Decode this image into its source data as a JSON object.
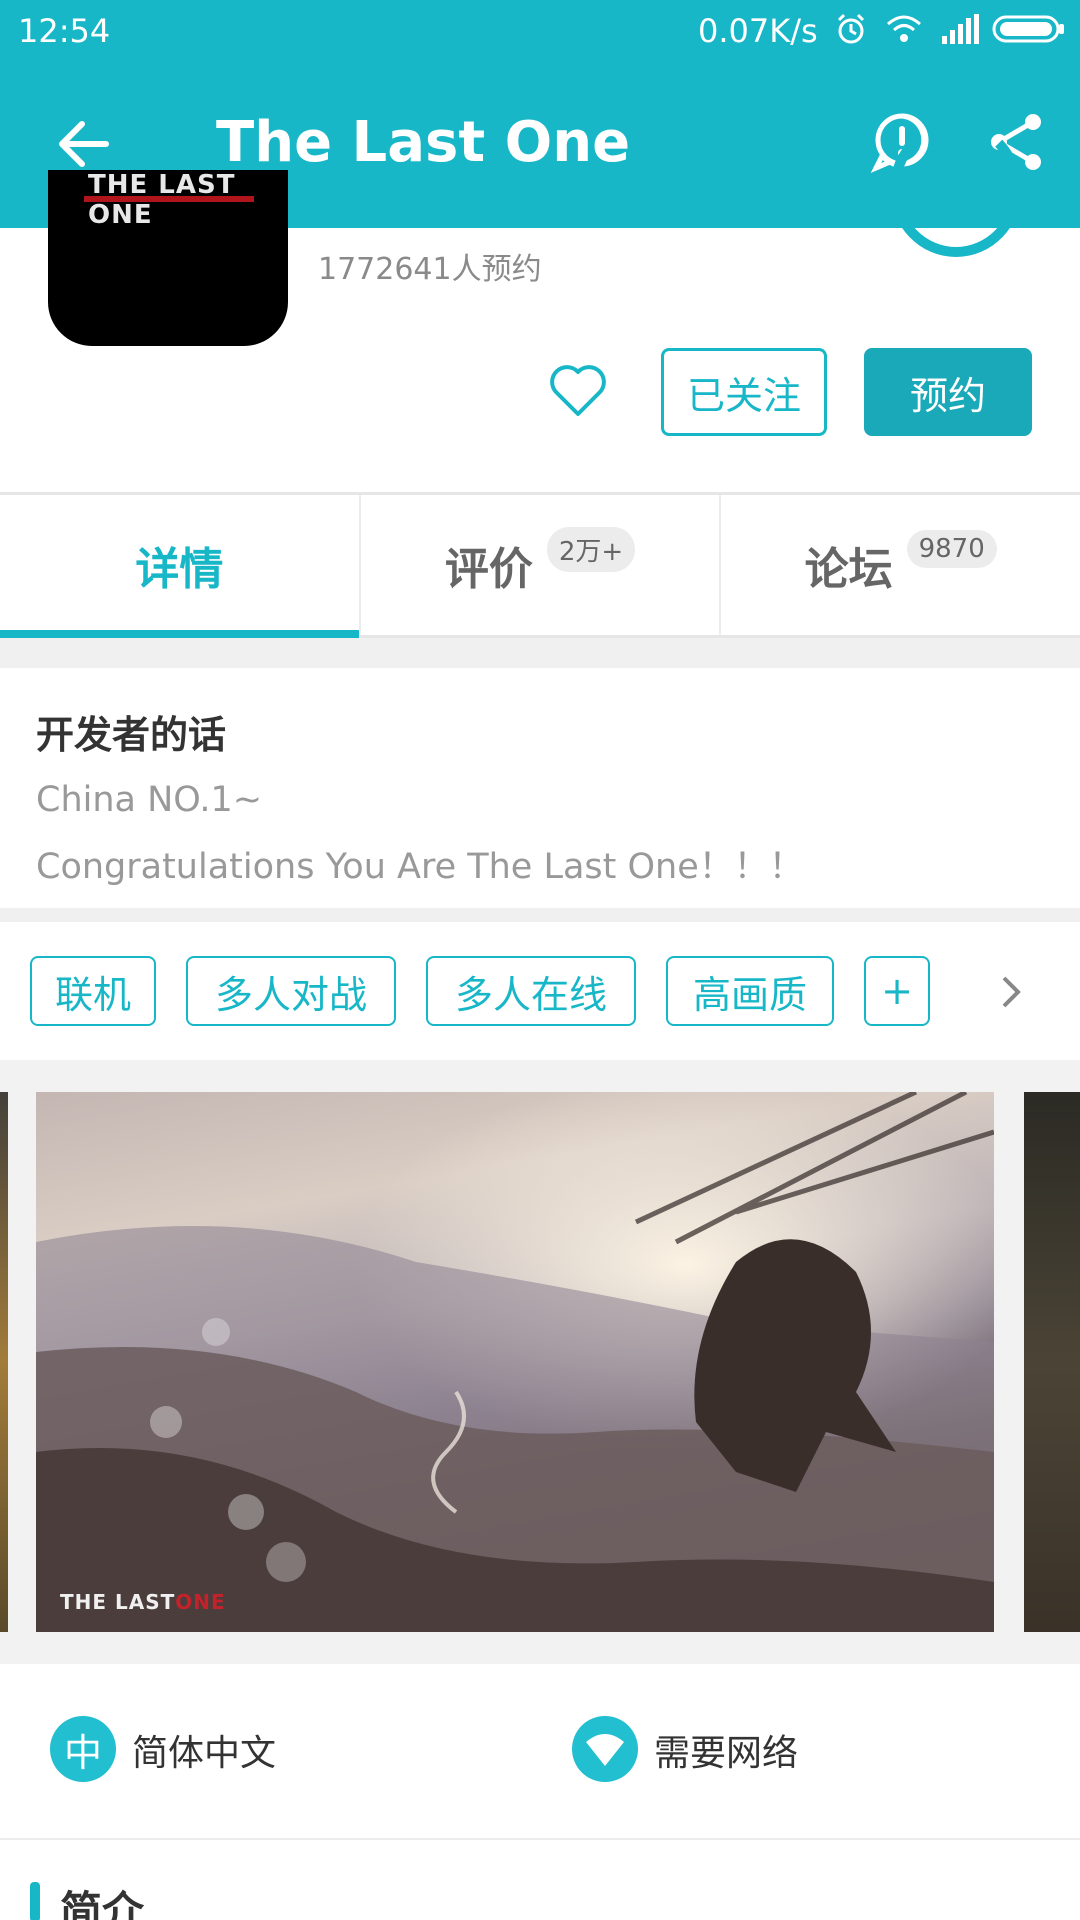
{
  "status_bar": {
    "time": "12:54",
    "net_speed": "0.07K/s",
    "icons": [
      "alarm-icon",
      "wifi-icon",
      "signal-icon",
      "battery-icon"
    ]
  },
  "app_bar": {
    "title": "The Last One",
    "back_icon": "back-arrow-icon",
    "report_icon": "report-icon",
    "share_icon": "share-icon"
  },
  "game": {
    "icon_logo_text": "THE LAST ONE",
    "reservations": "1772641人预约",
    "followed_label": "已关注",
    "reserve_label": "预约"
  },
  "tabs": [
    {
      "label": "详情",
      "badge": ""
    },
    {
      "label": "评价",
      "badge": "2万+"
    },
    {
      "label": "论坛",
      "badge": "9870"
    }
  ],
  "developer": {
    "heading": "开发者的话",
    "line1": "China NO.1~",
    "line2": "Congratulations You Are The Last One！！！"
  },
  "tags": [
    "联机",
    "多人对战",
    "多人在线",
    "高画质",
    "+"
  ],
  "gallery": {
    "logo_text": "THE LAST",
    "logo_red": "ONE"
  },
  "info": {
    "language_chip": "中",
    "language": "简体中文",
    "network": "需要网络"
  },
  "intro": {
    "title": "简介"
  },
  "colors": {
    "accent": "#18b7c8",
    "button": "#1aa9b8"
  }
}
